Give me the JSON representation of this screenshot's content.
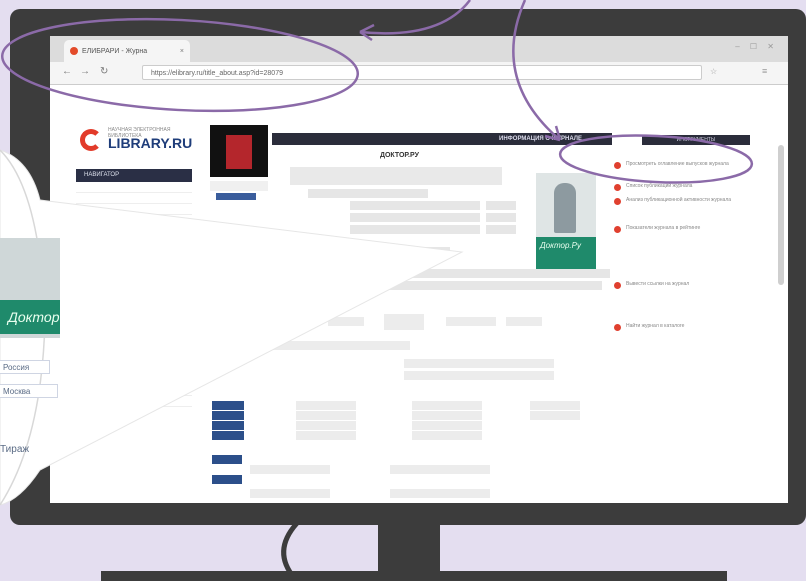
{
  "browser": {
    "tab_title": "ЕЛИБРАРИ - Журна",
    "tab_close": "×",
    "url": "https://elibrary.ru/title_about.asp?id=28079",
    "window_controls": "– ☐ ✕"
  },
  "site": {
    "logo_text": "LIBRARY.RU",
    "logo_subtitle": "НАУЧНАЯ ЭЛЕКТРОННАЯ БИБЛИОТЕКА",
    "sidebar_header": "НАВИГАТОР",
    "page_header": "ИНФОРМАЦИЯ О ЖУРНАЛЕ",
    "journal_title": "ДОКТОР.РУ",
    "cover_banner": "Доктор.Ру",
    "right_header": "ИНСТРУМЕНТЫ",
    "right_links": [
      "Просмотреть оглавление выпусков журнала",
      "Список публикаций журнала",
      "Анализ публикационной активности журнала",
      "Показатели журнала в рейтинге",
      "Вывести ссылки на журнал",
      "Найти журнал в каталоге"
    ]
  },
  "zoom": {
    "country": "Россия",
    "city": "Москва",
    "circulation": "Тираж",
    "banner": "Доктор"
  },
  "colors": {
    "monitor": "#3c3c3c",
    "background": "#e4def0",
    "annotation": "#8b6aa8",
    "accent_red": "#e23b2a",
    "header_dark": "#2b2d3b"
  }
}
